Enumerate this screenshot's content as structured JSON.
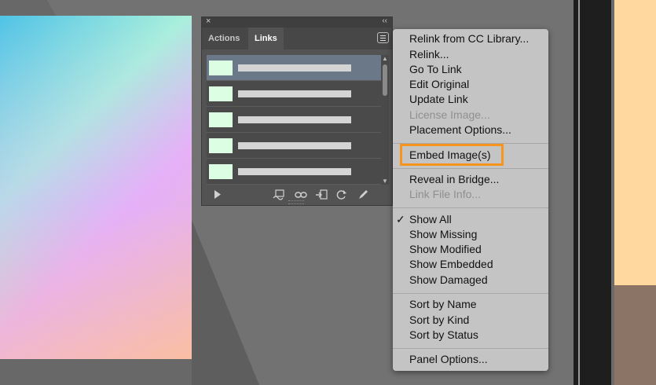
{
  "panel": {
    "tabs": [
      {
        "label": "Actions"
      },
      {
        "label": "Links"
      }
    ],
    "close_glyph": "×",
    "collapse_glyph": "‹‹"
  },
  "context_menu": {
    "items": [
      {
        "label": "Relink from CC Library...",
        "disabled": false
      },
      {
        "label": "Relink...",
        "disabled": false
      },
      {
        "label": "Go To Link",
        "disabled": false
      },
      {
        "label": "Edit Original",
        "disabled": false
      },
      {
        "label": "Update Link",
        "disabled": false
      },
      {
        "label": "License Image...",
        "disabled": true
      },
      {
        "label": "Placement Options...",
        "disabled": false
      },
      {
        "label": "Embed Image(s)",
        "disabled": false
      },
      {
        "label": "Reveal in Bridge...",
        "disabled": false
      },
      {
        "label": "Link File Info...",
        "disabled": true
      },
      {
        "label": "Show All",
        "disabled": false,
        "checked": true
      },
      {
        "label": "Show Missing",
        "disabled": false
      },
      {
        "label": "Show Modified",
        "disabled": false
      },
      {
        "label": "Show Embedded",
        "disabled": false
      },
      {
        "label": "Show Damaged",
        "disabled": false
      },
      {
        "label": "Sort by Name",
        "disabled": false
      },
      {
        "label": "Sort by Kind",
        "disabled": false
      },
      {
        "label": "Sort by Status",
        "disabled": false
      },
      {
        "label": "Panel Options...",
        "disabled": false
      }
    ],
    "checkmark": "✓"
  },
  "colors": {
    "highlight": "#f7941e",
    "menu_bg": "#c4c4c4",
    "panel_bg": "#535353"
  }
}
